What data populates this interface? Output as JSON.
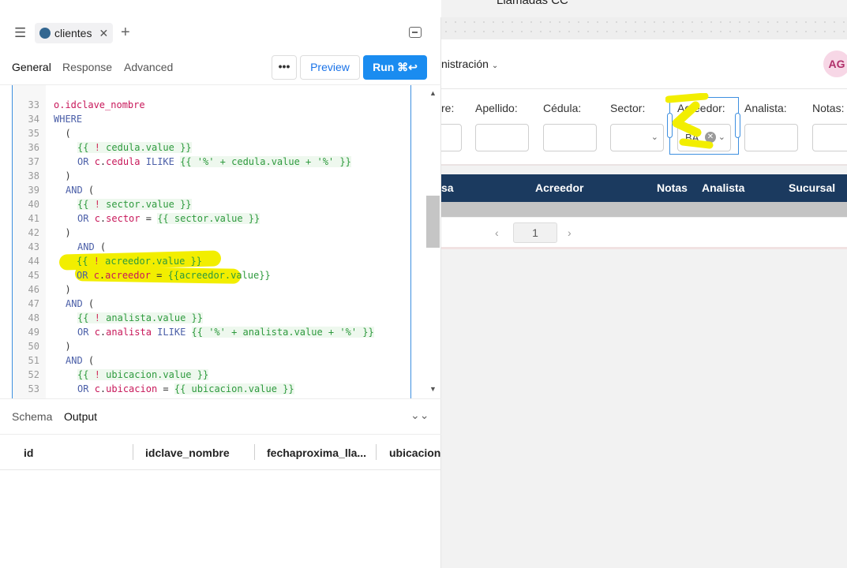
{
  "preview": {
    "app_title": "Llamadas CC",
    "nav_label": "nistración",
    "avatar_initials": "AG",
    "filters": [
      {
        "label": "re:"
      },
      {
        "label": "Apellido:"
      },
      {
        "label": "Cédula:"
      },
      {
        "label": "Sector:"
      },
      {
        "label": "Acreedor:",
        "value": "BA"
      },
      {
        "label": "Analista:"
      },
      {
        "label": "Notas:"
      }
    ],
    "table_headers": [
      "sa",
      "Acreedor",
      "Notas",
      "Analista",
      "Sucursal"
    ],
    "pagination": {
      "page": "1"
    }
  },
  "editor": {
    "query_tab": "clientes",
    "toolbar_tabs": [
      "General",
      "Response",
      "Advanced"
    ],
    "more_label": "•••",
    "preview_label": "Preview",
    "run_label": "Run ⌘↩",
    "code_first_line": "o.idclave_nombre",
    "line_numbers": [
      "33",
      "34",
      "35",
      "36",
      "37",
      "38",
      "39",
      "40",
      "41",
      "42",
      "43",
      "44",
      "45",
      "46",
      "47",
      "48",
      "49",
      "50",
      "51",
      "52",
      "53"
    ],
    "code": {
      "l34": "WHERE",
      "l35": "  (",
      "l36_a": "{{ ",
      "l36_b": "!",
      "l36_c": " cedula.value }}",
      "l37_a": "OR ",
      "l37_b": "c",
      "l37_c": ".",
      "l37_d": "cedula",
      "l37_e": " ILIKE ",
      "l37_f": "{{ '%' + cedula.value + '%' }}",
      "l38": "  )",
      "l39_a": "AND",
      "l39_b": " (",
      "l40_a": "{{ ",
      "l40_b": "!",
      "l40_c": " sector.value }}",
      "l41_a": "OR ",
      "l41_b": "c",
      "l41_c": ".",
      "l41_d": "sector",
      "l41_e": " = ",
      "l41_f": "{{ sector.value }}",
      "l42": "  )",
      "l43_a": "AND",
      "l43_b": " (",
      "l44_a": "{{ ",
      "l44_b": "!",
      "l44_c": " acreedor.value }}",
      "l45_a": "OR ",
      "l45_b": "c",
      "l45_c": ".",
      "l45_d": "acreedor",
      "l45_e": " = ",
      "l45_f": "{{acreedor.value}}",
      "l46": "  )",
      "l47_a": "AND",
      "l47_b": " (",
      "l48_a": "{{ ",
      "l48_b": "!",
      "l48_c": " analista.value }}",
      "l49_a": "OR ",
      "l49_b": "c",
      "l49_c": ".",
      "l49_d": "analista",
      "l49_e": " ILIKE ",
      "l49_f": "{{ '%' + analista.value + '%' }}",
      "l50": "  )",
      "l51_a": "AND",
      "l51_b": " (",
      "l52_a": "{{ ",
      "l52_b": "!",
      "l52_c": " ubicacion.value }}",
      "l53_a": "OR ",
      "l53_b": "c",
      "l53_c": ".",
      "l53_d": "ubicacion",
      "l53_e": " = ",
      "l53_f": "{{ ubicacion.value }}"
    },
    "bottom_tabs": [
      "Schema",
      "Output"
    ],
    "result_columns": [
      "id",
      "idclave_nombre",
      "fechaproxima_lla...",
      "ubicacion"
    ]
  },
  "colors": {
    "accent": "#1a8cf0",
    "table_header": "#1b3a5f",
    "highlight": "#f2ee00"
  }
}
